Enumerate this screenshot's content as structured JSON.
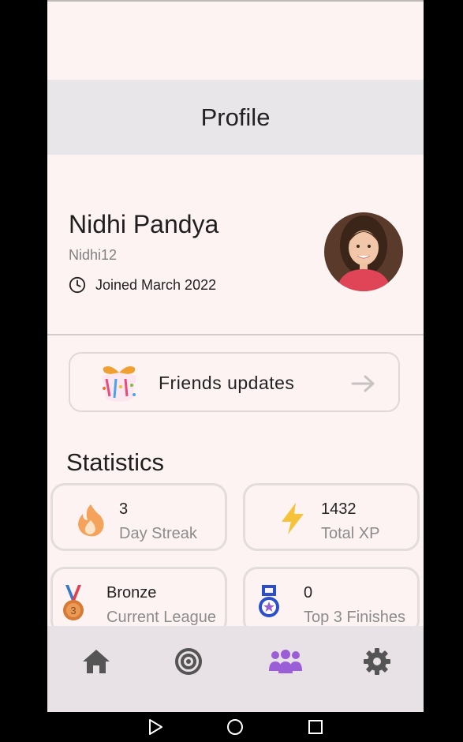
{
  "appbar": {
    "title": "Profile"
  },
  "profile": {
    "name": "Nidhi Pandya",
    "username": "Nidhi12",
    "joined": "Joined March 2022"
  },
  "friends": {
    "label": "Friends updates",
    "icon": "gift-icon"
  },
  "statistics": {
    "title": "Statistics",
    "cards": [
      {
        "value": "3",
        "label": "Day Streak",
        "icon": "flame-icon"
      },
      {
        "value": "1432",
        "label": "Total XP",
        "icon": "lightning-icon"
      },
      {
        "value": "Bronze",
        "label": "Current League",
        "icon": "bronze-medal-icon"
      },
      {
        "value": "0",
        "label": "Top 3 Finishes",
        "icon": "medal-star-icon"
      }
    ]
  },
  "bottom_nav": {
    "items": [
      "home-icon",
      "target-icon",
      "group-icon",
      "settings-icon"
    ],
    "active_index": 2,
    "active_color": "#9a5fd6",
    "inactive_color": "#555555"
  },
  "system_nav": [
    "back-icon",
    "home-circle-icon",
    "recents-icon"
  ]
}
